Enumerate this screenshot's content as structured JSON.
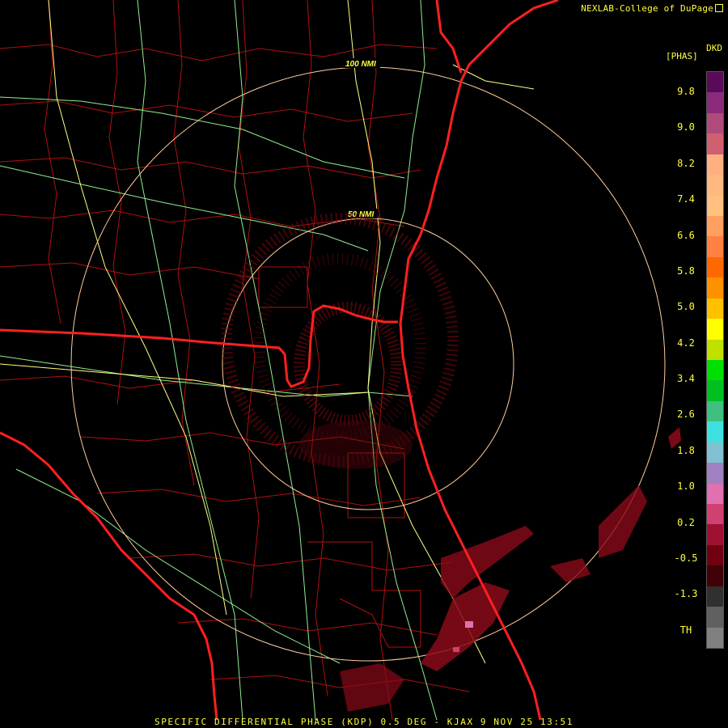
{
  "credit": "NEXLAB-College of DuPage",
  "legend": {
    "product_code": "DKD",
    "unit": "[PHAS]",
    "ticks": [
      "9.8",
      "9.0",
      "8.2",
      "7.4",
      "6.6",
      "5.8",
      "5.0",
      "4.2",
      "3.4",
      "2.6",
      "1.8",
      "1.0",
      "0.2",
      "-0.5",
      "-1.3",
      "TH"
    ],
    "bands": [
      "#5a0a5a",
      "#8a2a7a",
      "#b04a7a",
      "#d06070",
      "#ffb080",
      "#ffb880",
      "#ffc080",
      "#ffa060",
      "#ff8040",
      "#ff6800",
      "#ff9000",
      "#ffc000",
      "#ffff00",
      "#c0e000",
      "#00e000",
      "#00c020",
      "#40c080",
      "#40e0e0",
      "#80c0d0",
      "#a080c0",
      "#e070b0",
      "#d04070",
      "#a01030",
      "#700010",
      "#400008",
      "#303030",
      "#606060",
      "#808080"
    ]
  },
  "range_rings": {
    "inner_label": "50 NMI",
    "outer_label": "100 NMI"
  },
  "colors": {
    "state_border": "#ff2020",
    "county_border": "#c01010",
    "highway_green": "#90ee90",
    "highway_yellow": "#ffff80",
    "ring": "#ffcc99",
    "echo": "#8a0a1a"
  },
  "footer": "SPECIFIC DIFFERENTIAL PHASE (KDP) 0.5 DEG - KJAX 9 NOV 25 13:51"
}
